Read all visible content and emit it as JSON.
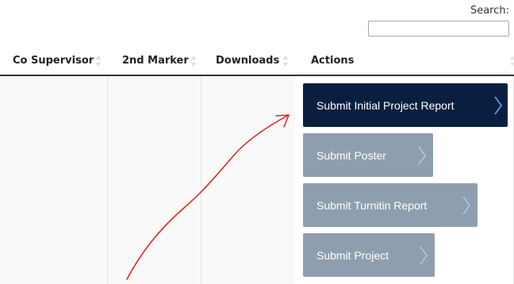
{
  "search": {
    "label": "Search:",
    "value": "",
    "placeholder": ""
  },
  "table": {
    "columns": [
      {
        "label": "Co Supervisor"
      },
      {
        "label": "2nd Marker"
      },
      {
        "label": "Downloads"
      },
      {
        "label": "Actions"
      }
    ],
    "actions": [
      {
        "label": "Submit Initial Project Report",
        "state": "active"
      },
      {
        "label": "Submit Poster",
        "state": "inactive"
      },
      {
        "label": "Submit Turnitin Report",
        "state": "inactive"
      },
      {
        "label": "Submit Project",
        "state": "inactive"
      }
    ]
  },
  "colors": {
    "primary_button": "#0a1f3f",
    "secondary_button": "#8f9eae",
    "annotation_arrow": "#e02020",
    "header_border": "#333333"
  },
  "icons": {
    "sort": "sort-both-icon",
    "chevron": "chevron-right-icon"
  }
}
